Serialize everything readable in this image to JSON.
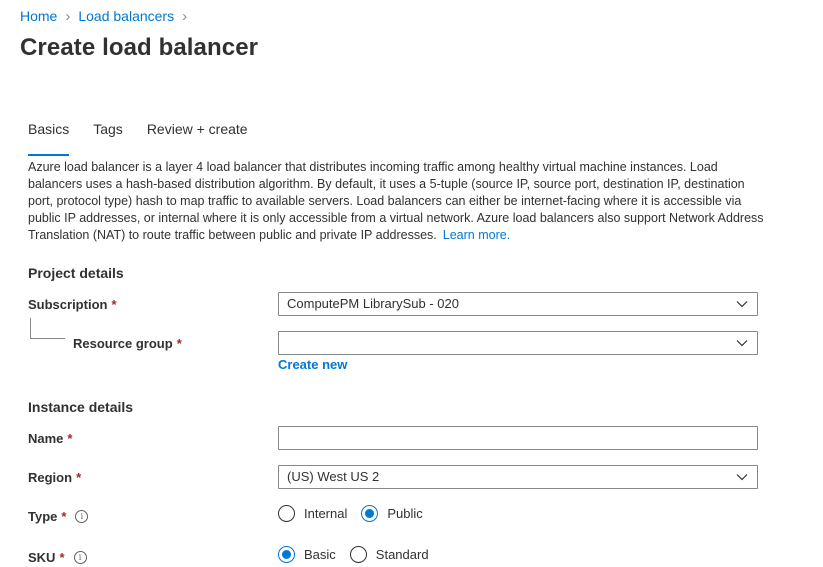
{
  "breadcrumb": {
    "home": "Home",
    "load_balancers": "Load balancers",
    "sep": "›"
  },
  "page_title": "Create load balancer",
  "tabs": [
    {
      "label": "Basics",
      "active": true
    },
    {
      "label": "Tags",
      "active": false
    },
    {
      "label": "Review + create",
      "active": false
    }
  ],
  "description": "Azure load balancer is a layer 4 load balancer that distributes incoming traffic among healthy virtual machine instances. Load balancers uses a hash-based distribution algorithm. By default, it uses a 5-tuple (source IP, source port, destination IP, destination port, protocol type) hash to map traffic to available servers. Load balancers can either be internet-facing where it is accessible via public IP addresses, or internal where it is only accessible from a virtual network. Azure load balancers also support Network Address Translation (NAT) to route traffic between public and private IP addresses.",
  "learn_more": "Learn more.",
  "project_details": {
    "heading": "Project details",
    "subscription": {
      "label": "Subscription",
      "required": "*",
      "value": "ComputePM LibrarySub - 020"
    },
    "resource_group": {
      "label": "Resource group",
      "required": "*",
      "value": "",
      "create_new": "Create new"
    }
  },
  "instance_details": {
    "heading": "Instance details",
    "name": {
      "label": "Name",
      "required": "*",
      "value": ""
    },
    "region": {
      "label": "Region",
      "required": "*",
      "value": "(US) West US 2"
    },
    "type": {
      "label": "Type",
      "required": "*",
      "info": "i",
      "options": [
        "Internal",
        "Public"
      ],
      "selected": "Public"
    },
    "sku": {
      "label": "SKU",
      "required": "*",
      "info": "i",
      "options": [
        "Basic",
        "Standard"
      ],
      "selected": "Basic"
    }
  },
  "colors": {
    "accent": "#0078d4",
    "required": "#a4262c",
    "text": "#323130",
    "border": "#8a8886"
  }
}
